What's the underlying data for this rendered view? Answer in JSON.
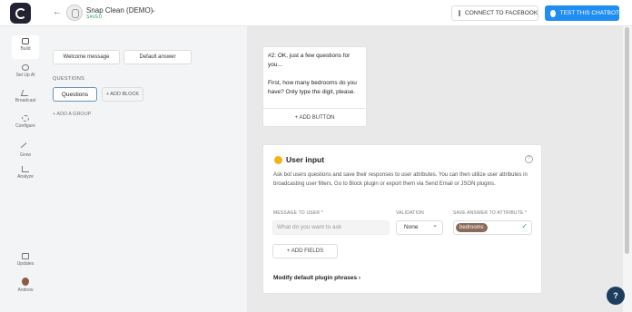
{
  "topbar": {
    "bot_name": "Snap Clean (DEMO)",
    "saved_status": "SAVED",
    "connect_button": "CONNECT TO FACEBOOK",
    "test_button": "TEST THIS CHATBOT"
  },
  "nav": {
    "items": [
      {
        "label": "Build",
        "icon": "build-icon"
      },
      {
        "label": "Set Up AI",
        "icon": "ai-icon"
      },
      {
        "label": "Broadcast",
        "icon": "broadcast-icon"
      },
      {
        "label": "Configure",
        "icon": "gear-icon"
      },
      {
        "label": "Grow",
        "icon": "grow-icon"
      },
      {
        "label": "Analyze",
        "icon": "chart-icon"
      }
    ],
    "updates_label": "Updates",
    "user_label": "Andrew"
  },
  "sidebar": {
    "welcome_message": "Welcome message",
    "default_answer": "Default answer",
    "questions_heading": "QUESTIONS",
    "questions_block": "Questions",
    "add_block": "+ ADD BLOCK",
    "add_group": "+ ADD A GROUP"
  },
  "text_card": {
    "message": "#2: OK, just a few questions for you...\n\nFirst, how many bedrooms do you have? Only type the digit, please.",
    "add_button": "+ ADD BUTTON"
  },
  "user_input": {
    "title": "User input",
    "description": "Ask bot users questions and save their responses to user attributes. You can then utilize user attributes in broadcasting user filters, Go to Block plugin or export them via Send Email or JSON plugins.",
    "message_label": "MESSAGE TO USER *",
    "message_placeholder": "What do you want to ask",
    "validation_label": "VALIDATION",
    "validation_value": "None",
    "attribute_label": "SAVE ANSWER TO ATTRIBUTE *",
    "attribute_value": "bedrooms",
    "add_fields": "+ ADD FIELDS",
    "modify_phrases": "Modify default plugin phrases"
  },
  "help": {
    "symbol": "?"
  }
}
